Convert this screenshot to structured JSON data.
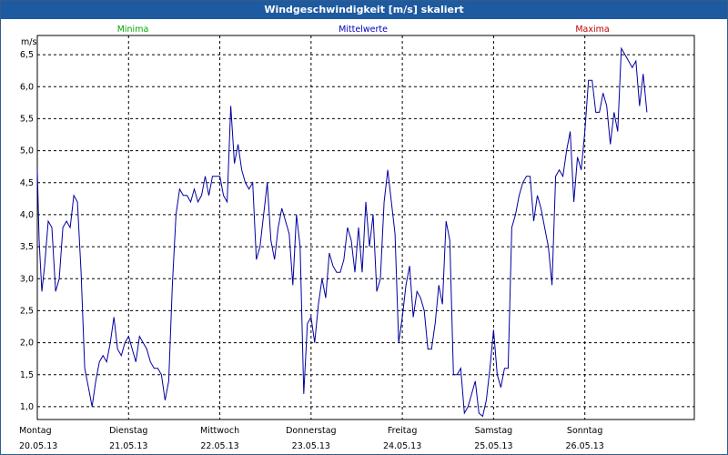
{
  "window": {
    "title": "Windgeschwindigkeit [m/s] skaliert"
  },
  "colors": {
    "title_bar": "#1e5aa0",
    "line": "#0000a0",
    "minima": "#00aa00",
    "mittelwerte": "#0000c0",
    "maxima": "#c00000",
    "grid": "#000000"
  },
  "chart_data": {
    "type": "line",
    "title": "Windgeschwindigkeit [m/s] skaliert",
    "ylabel": "m/s",
    "ylim": [
      0.8,
      6.8
    ],
    "yticks": [
      "6,5",
      "6,0",
      "5,5",
      "5,0",
      "4,5",
      "4,0",
      "3,5",
      "3,0",
      "2,5",
      "2,0",
      "1,5",
      "1,0"
    ],
    "ytick_values": [
      6.5,
      6.0,
      5.5,
      5.0,
      4.5,
      4.0,
      3.5,
      3.0,
      2.5,
      2.0,
      1.5,
      1.0
    ],
    "x_labels": [
      {
        "day": "Montag",
        "date": "20.05.13"
      },
      {
        "day": "Dienstag",
        "date": "21.05.13"
      },
      {
        "day": "Mittwoch",
        "date": "22.05.13"
      },
      {
        "day": "Donnerstag",
        "date": "23.05.13"
      },
      {
        "day": "Freitag",
        "date": "24.05.13"
      },
      {
        "day": "Samstag",
        "date": "25.05.13"
      },
      {
        "day": "Sonntag",
        "date": "26.05.13"
      }
    ],
    "legend": [
      "Minima",
      "Mittelwerte",
      "Maxima"
    ],
    "grid": true,
    "series": [
      {
        "name": "Mittelwerte",
        "x_days": [
          0.0,
          0.02,
          0.05,
          0.08,
          0.12,
          0.16,
          0.2,
          0.24,
          0.28,
          0.32,
          0.36,
          0.4,
          0.44,
          0.48,
          0.52,
          0.56,
          0.6,
          0.64,
          0.68,
          0.72,
          0.76,
          0.8,
          0.84,
          0.88,
          0.92,
          0.96,
          1.0,
          1.04,
          1.08,
          1.12,
          1.16,
          1.2,
          1.24,
          1.28,
          1.32,
          1.36,
          1.4,
          1.44,
          1.48,
          1.52,
          1.56,
          1.6,
          1.64,
          1.68,
          1.72,
          1.76,
          1.8,
          1.84,
          1.88,
          1.92,
          1.96,
          2.0,
          2.04,
          2.08,
          2.12,
          2.16,
          2.2,
          2.24,
          2.28,
          2.32,
          2.36,
          2.4,
          2.44,
          2.48,
          2.52,
          2.56,
          2.6,
          2.64,
          2.68,
          2.72,
          2.76,
          2.8,
          2.84,
          2.88,
          2.92,
          2.96,
          3.0,
          3.04,
          3.08,
          3.12,
          3.16,
          3.2,
          3.24,
          3.28,
          3.32,
          3.36,
          3.4,
          3.44,
          3.48,
          3.52,
          3.56,
          3.6,
          3.64,
          3.68,
          3.72,
          3.76,
          3.8,
          3.84,
          3.88,
          3.92,
          3.96,
          4.0,
          4.04,
          4.08,
          4.12,
          4.16,
          4.2,
          4.24,
          4.28,
          4.32,
          4.36,
          4.4,
          4.44,
          4.48,
          4.52,
          4.56,
          4.6,
          4.64,
          4.68,
          4.72,
          4.76,
          4.8,
          4.84,
          4.88,
          4.92,
          4.96,
          5.0,
          5.04,
          5.08,
          5.12,
          5.16,
          5.2,
          5.24,
          5.28,
          5.32,
          5.36,
          5.4,
          5.44,
          5.48,
          5.52,
          5.56,
          5.6,
          5.64,
          5.68,
          5.72,
          5.76,
          5.8,
          5.84,
          5.88,
          5.92,
          5.96,
          6.0,
          6.04,
          6.08,
          6.12,
          6.16,
          6.2,
          6.24,
          6.28,
          6.32,
          6.36,
          6.4,
          6.44,
          6.48,
          6.52,
          6.56,
          6.6,
          6.64,
          6.68,
          6.72,
          6.76,
          6.8,
          6.84,
          6.88,
          6.92,
          6.96,
          7.0,
          7.04,
          7.08,
          7.12,
          7.16,
          7.2
        ],
        "values": [
          4.7,
          3.6,
          2.8,
          3.2,
          3.9,
          3.8,
          2.8,
          3.0,
          3.8,
          3.9,
          3.8,
          4.3,
          4.2,
          3.1,
          1.6,
          1.3,
          1.0,
          1.4,
          1.7,
          1.8,
          1.7,
          2.0,
          2.4,
          1.9,
          1.8,
          2.0,
          2.1,
          1.9,
          1.7,
          2.1,
          2.0,
          1.9,
          1.7,
          1.6,
          1.6,
          1.5,
          1.1,
          1.4,
          2.9,
          4.0,
          4.4,
          4.3,
          4.3,
          4.2,
          4.4,
          4.2,
          4.3,
          4.6,
          4.3,
          4.6,
          4.6,
          4.6,
          4.3,
          4.2,
          5.7,
          4.8,
          5.1,
          4.7,
          4.5,
          4.4,
          4.5,
          3.3,
          3.5,
          4.0,
          4.5,
          3.6,
          3.3,
          3.8,
          4.1,
          3.9,
          3.7,
          2.9,
          4.0,
          3.5,
          1.2,
          2.3,
          2.4,
          2.0,
          2.6,
          3.0,
          2.7,
          3.4,
          3.2,
          3.1,
          3.1,
          3.3,
          3.8,
          3.6,
          3.1,
          3.8,
          3.1,
          4.2,
          3.5,
          4.0,
          2.8,
          3.0,
          4.2,
          4.7,
          4.2,
          3.7,
          2.0,
          2.4,
          2.9,
          3.2,
          2.4,
          2.8,
          2.7,
          2.5,
          1.9,
          1.9,
          2.3,
          2.9,
          2.6,
          3.9,
          3.6,
          1.5,
          1.5,
          1.6,
          0.9,
          1.0,
          1.2,
          1.4,
          0.9,
          0.85,
          1.1,
          1.6,
          2.2,
          1.5,
          1.3,
          1.6,
          1.6,
          3.8,
          4.0,
          4.3,
          4.5,
          4.6,
          4.6,
          3.9,
          4.3,
          4.1,
          3.8,
          3.5,
          2.9,
          4.6,
          4.7,
          4.6,
          5.0,
          5.3,
          4.2,
          4.9,
          4.7,
          5.3,
          6.1,
          6.1,
          5.6,
          5.6,
          5.9,
          5.7,
          5.1,
          5.6,
          5.3,
          6.6,
          6.5,
          6.4,
          6.3,
          6.4,
          5.7,
          6.2,
          5.6
        ]
      }
    ]
  }
}
